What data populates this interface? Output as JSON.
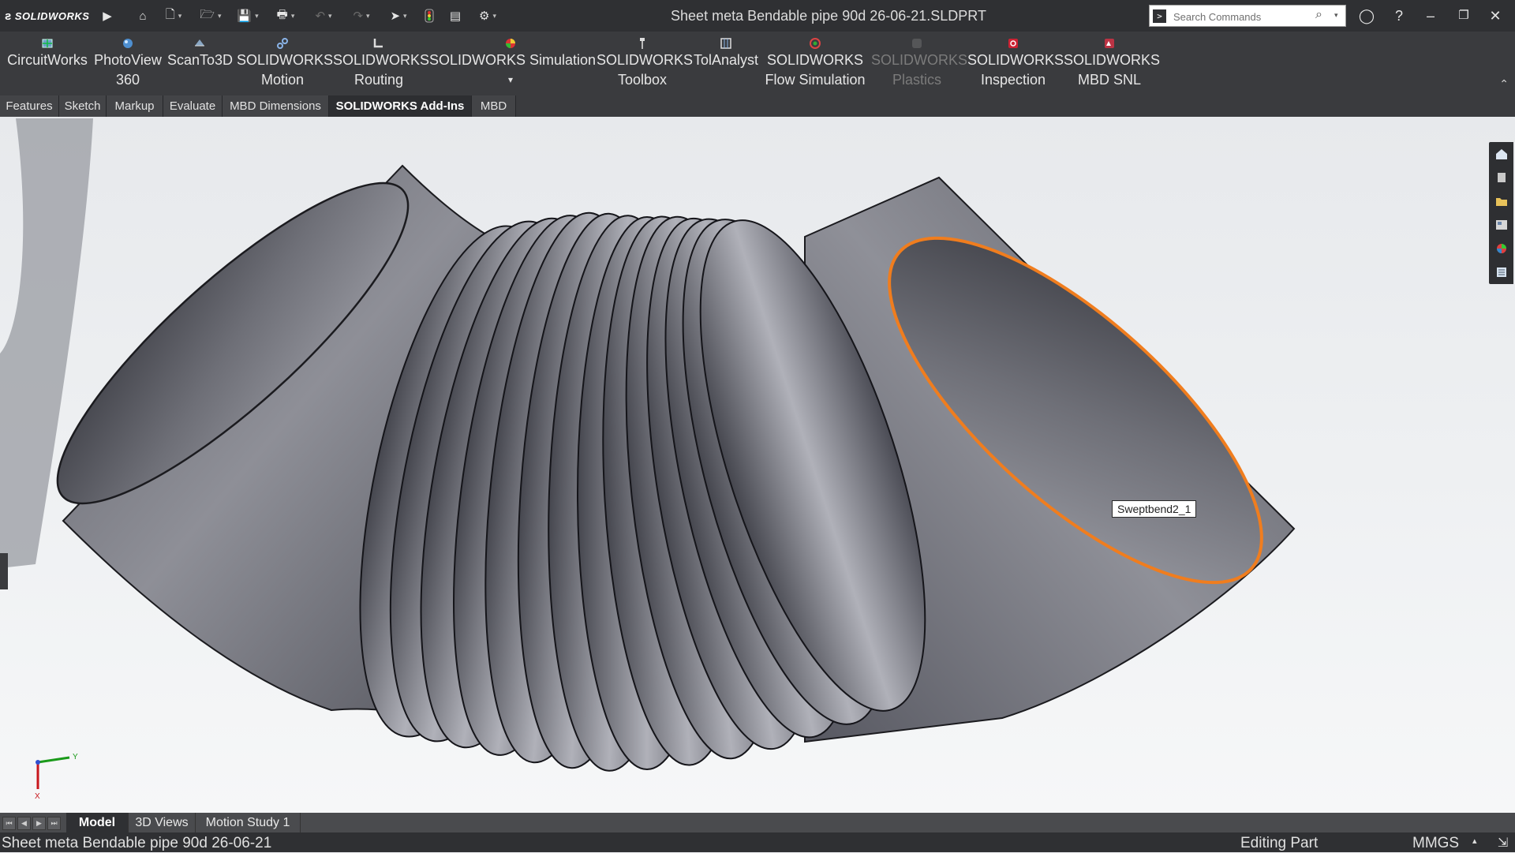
{
  "app": {
    "logo_text": "SOLIDWORKS",
    "document_title": "Sheet meta Bendable pipe 90d  26-06-21.SLDPRT"
  },
  "search": {
    "placeholder": "Search Commands"
  },
  "command_manager": {
    "items": [
      {
        "label": "CircuitWorks",
        "label2": "",
        "icon": "circuitworks-icon",
        "enabled": true
      },
      {
        "label": "PhotoView",
        "label2": "360",
        "icon": "photoview-icon",
        "enabled": true
      },
      {
        "label": "ScanTo3D",
        "label2": "",
        "icon": "scanto3d-icon",
        "enabled": true
      },
      {
        "label": "SOLIDWORKS",
        "label2": "Motion",
        "icon": "motion-icon",
        "enabled": true
      },
      {
        "label": "SOLIDWORKS",
        "label2": "Routing",
        "icon": "routing-icon",
        "enabled": true
      },
      {
        "label": "SOLIDWORKS Simulation",
        "label2": "▾",
        "icon": "simulation-icon",
        "enabled": true
      },
      {
        "label": "SOLIDWORKS",
        "label2": "Toolbox",
        "icon": "toolbox-icon",
        "enabled": true
      },
      {
        "label": "TolAnalyst",
        "label2": "",
        "icon": "tolanalyst-icon",
        "enabled": true
      },
      {
        "label": "SOLIDWORKS",
        "label2": "Flow Simulation",
        "icon": "flow-simulation-icon",
        "enabled": true
      },
      {
        "label": "SOLIDWORKS",
        "label2": "Plastics",
        "icon": "plastics-icon",
        "enabled": false
      },
      {
        "label": "SOLIDWORKS",
        "label2": "Inspection",
        "icon": "inspection-icon",
        "enabled": true
      },
      {
        "label": "SOLIDWORKS",
        "label2": "MBD SNL",
        "icon": "mbd-snl-icon",
        "enabled": true
      }
    ]
  },
  "tabs": [
    {
      "label": "Features",
      "active": false
    },
    {
      "label": "Sketch",
      "active": false
    },
    {
      "label": "Markup",
      "active": false
    },
    {
      "label": "Evaluate",
      "active": false
    },
    {
      "label": "MBD Dimensions",
      "active": false
    },
    {
      "label": "SOLIDWORKS Add-Ins",
      "active": true
    },
    {
      "label": "MBD",
      "active": false
    }
  ],
  "viewport": {
    "callout": "Sweptbend2_1",
    "edge_highlight_color": "#f07d1e",
    "triad": {
      "y": "Y",
      "x": "X"
    }
  },
  "bottom_tabs": [
    {
      "label": "Model",
      "active": true
    },
    {
      "label": "3D Views",
      "active": false
    },
    {
      "label": "Motion Study 1",
      "active": false
    }
  ],
  "status": {
    "left": "Sheet meta Bendable pipe 90d  26-06-21",
    "mode": "Editing Part",
    "units": "MMGS",
    "units_caret": "▴"
  },
  "colors": {
    "titlebar": "#2f3033",
    "commandbar": "#3a3b3e",
    "accent": "#f07d1e"
  }
}
